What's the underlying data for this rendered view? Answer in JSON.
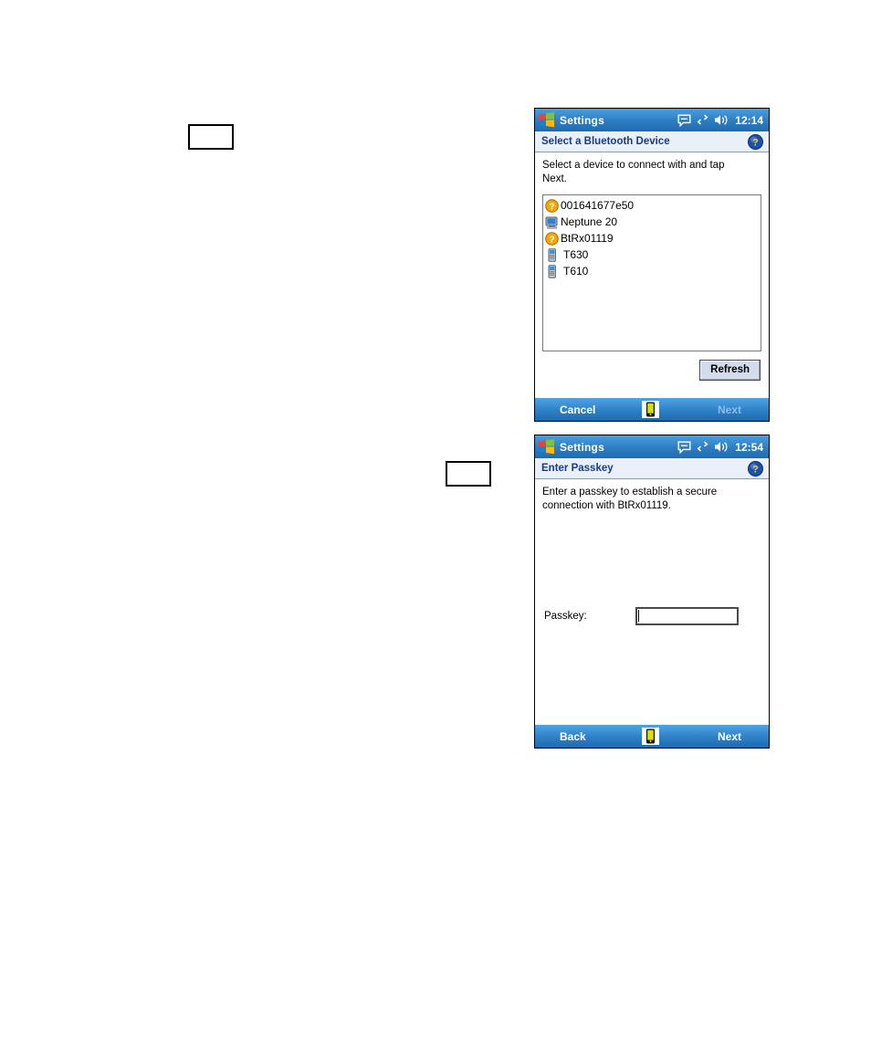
{
  "page": {
    "background": "#ffffff",
    "callouts": [
      {
        "name": "callout-one",
        "text": ""
      },
      {
        "name": "callout-two",
        "text": ""
      }
    ]
  },
  "colors": {
    "titlebar_blue": "#2f7fc4",
    "subtitle_text": "#1a3c86",
    "subtitle_bg": "#e9f0fa",
    "command_bar_blue": "#2e80c6",
    "disabled_text": "#8fbde4",
    "button_face": "#d2dced",
    "help_icon_blue": "#1c4fb0",
    "help_icon_mark": "#ffd200",
    "device_unknown_icon": "#f5a800"
  },
  "screens": [
    {
      "id": "select-device",
      "titlebar": {
        "logo_icon": "windows-flag-icon",
        "title": "Settings",
        "tray": {
          "messaging_icon": "speech-bubble-icon",
          "connectivity_icon": "connectivity-arrows-icon",
          "volume_icon": "speaker-icon",
          "clock": "12:14"
        }
      },
      "header": {
        "title": "Select a Bluetooth Device",
        "help_icon": "help-question-icon"
      },
      "instruction": "Select a device to connect with and tap Next.",
      "device_list": {
        "items": [
          {
            "label": "001641677e50",
            "icon": "unknown-device-icon"
          },
          {
            "label": "Neptune 20",
            "icon": "computer-icon"
          },
          {
            "label": "BtRx01119",
            "icon": "unknown-device-icon"
          },
          {
            "label": "T630",
            "icon": "mobile-phone-icon"
          },
          {
            "label": "T610",
            "icon": "mobile-phone-icon"
          }
        ]
      },
      "refresh_label": "Refresh",
      "commandbar": {
        "left_label": "Cancel",
        "left_enabled": true,
        "sip_icon": "keyboard-sip-icon",
        "right_label": "Next",
        "right_enabled": false
      }
    },
    {
      "id": "enter-passkey",
      "titlebar": {
        "logo_icon": "windows-flag-icon",
        "title": "Settings",
        "tray": {
          "messaging_icon": "speech-bubble-icon",
          "connectivity_icon": "connectivity-arrows-icon",
          "volume_icon": "speaker-icon",
          "clock": "12:54"
        }
      },
      "header": {
        "title": "Enter Passkey",
        "help_icon": "help-question-icon"
      },
      "instruction": "Enter a passkey to establish a secure connection with BtRx01119.",
      "passkey": {
        "label": "Passkey:",
        "value": "",
        "placeholder": ""
      },
      "commandbar": {
        "left_label": "Back",
        "left_enabled": true,
        "sip_icon": "keyboard-sip-icon",
        "right_label": "Next",
        "right_enabled": true
      }
    }
  ]
}
